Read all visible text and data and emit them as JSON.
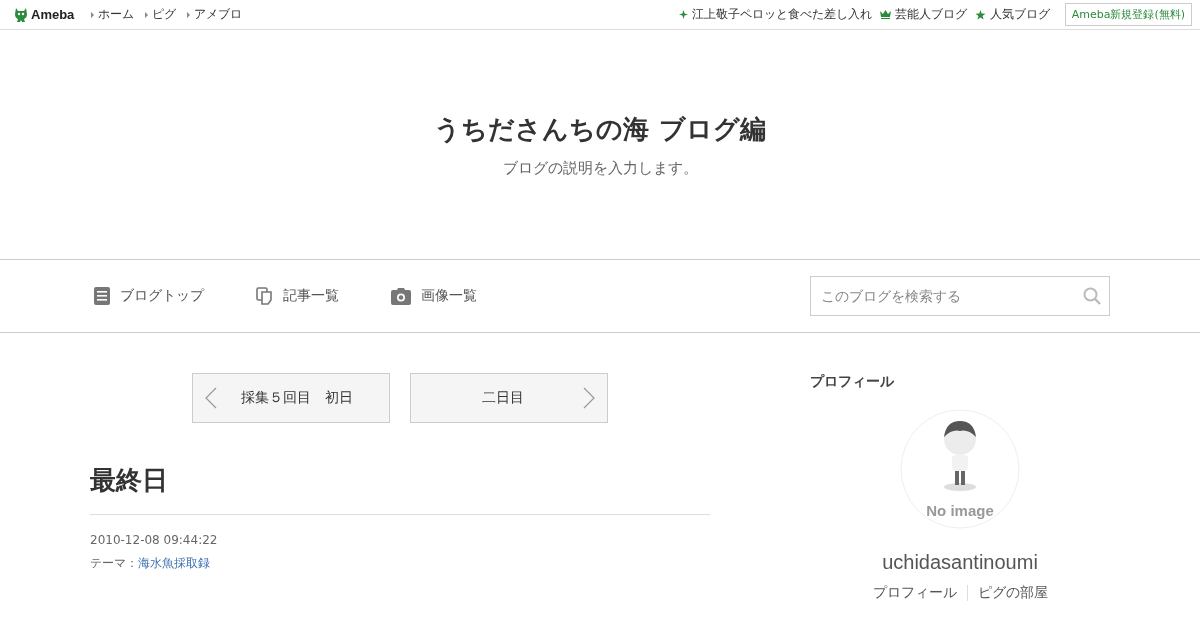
{
  "header": {
    "logo": "Ameba",
    "links": [
      "ホーム",
      "ピグ",
      "アメブロ"
    ],
    "right_links": [
      {
        "kind": "sparkle",
        "label": "江上敬子ペロッと食べた差し入れ"
      },
      {
        "kind": "crown",
        "label": "芸能人ブログ"
      },
      {
        "kind": "star",
        "label": "人気ブログ"
      }
    ],
    "signup": "Ameba新規登録(無料)"
  },
  "blog": {
    "title": "うちださんちの海 ブログ編",
    "description": "ブログの説明を入力します。"
  },
  "nav": {
    "items": [
      {
        "kind": "doc",
        "label": "ブログトップ"
      },
      {
        "kind": "copy",
        "label": "記事一覧"
      },
      {
        "kind": "camera",
        "label": "画像一覧"
      }
    ],
    "search": {
      "placeholder": "このブログを検索する"
    }
  },
  "pager": {
    "prev": "採集５回目　初日",
    "next": "二日目"
  },
  "article": {
    "title": "最終日",
    "date": "2010-12-08 09:44:22",
    "theme_label": "テーマ：",
    "theme": "海水魚採取録"
  },
  "profile": {
    "heading": "プロフィール",
    "avatar_caption": "No image",
    "name": "uchidasantinoumi",
    "links": [
      "プロフィール",
      "ピグの部屋"
    ]
  }
}
